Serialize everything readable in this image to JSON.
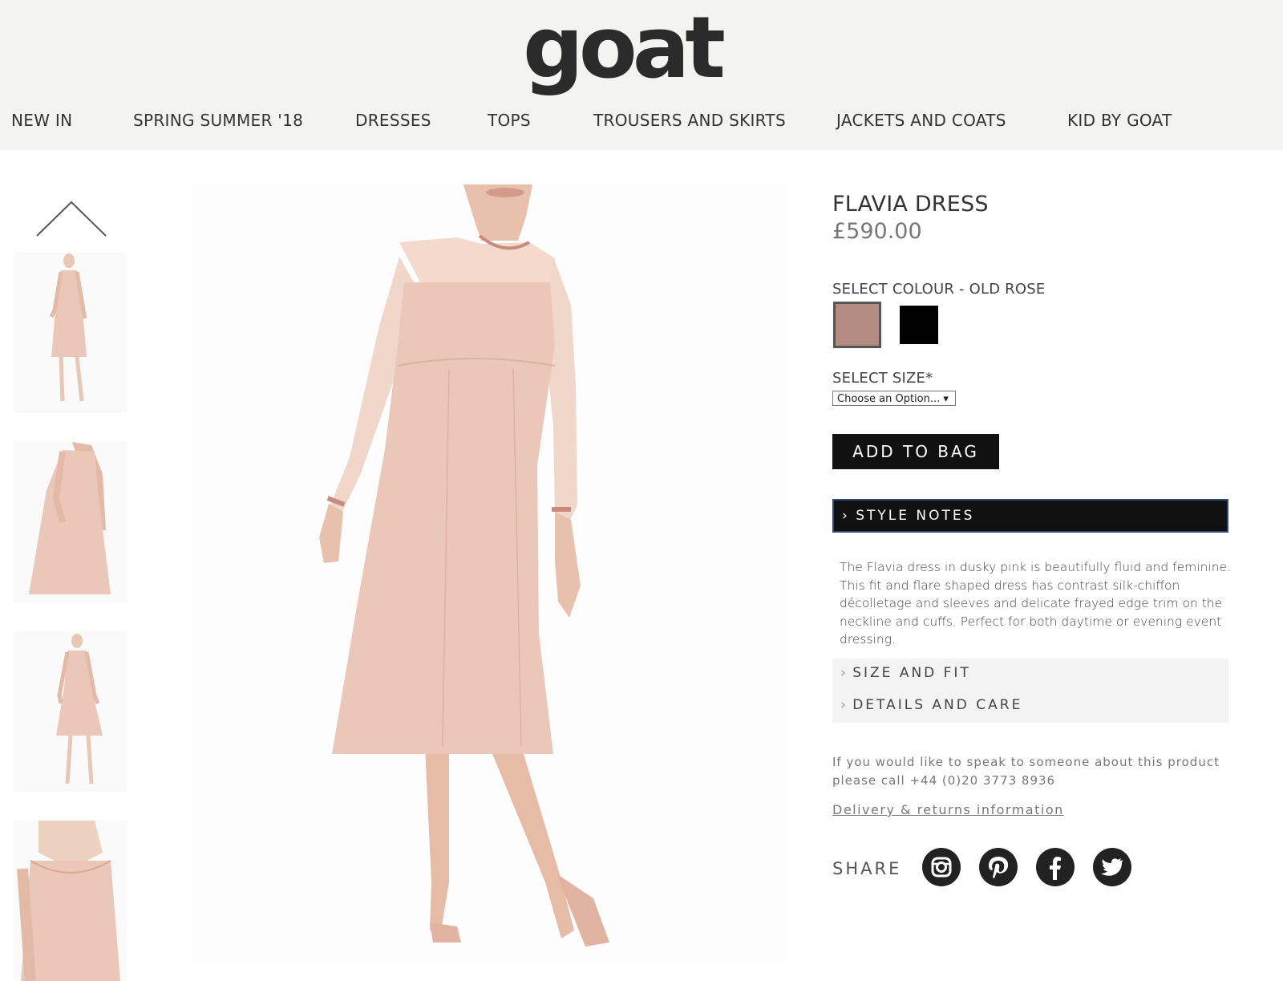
{
  "header": {
    "logo": "goat",
    "nav": [
      "NEW IN",
      "SPRING SUMMER '18",
      "DRESSES",
      "TOPS",
      "TROUSERS AND SKIRTS",
      "JACKETS AND COATS",
      "KID BY GOAT"
    ]
  },
  "gallery": {
    "up_arrow_icon": "chevron-up-icon",
    "thumbnail_count": 4
  },
  "product": {
    "title": "FLAVIA DRESS",
    "price": "£590.00",
    "colour_label": "SELECT COLOUR - OLD ROSE",
    "colours": [
      {
        "name": "old-rose",
        "hex": "#b48b80",
        "selected": true
      },
      {
        "name": "black",
        "hex": "#000000",
        "selected": false
      }
    ],
    "size_label": "SELECT SIZE*",
    "size_select": "Choose an Option... ▾",
    "add_to_bag": "ADD TO BAG",
    "style_notes": "STYLE NOTES",
    "description": "The Flavia dress in dusky pink is beautifully fluid and feminine. This fit and flare shaped dress has contrast silk-chiffon décolletage and sleeves and delicate frayed edge trim on the neckline and cuffs. Perfect for both daytime or evening event dressing.",
    "size_and_fit": "SIZE AND FIT",
    "details_and_care": "DETAILS AND CARE",
    "help_text_1": "If you would like to speak to someone about this product",
    "help_text_2": "please call +44 (0)20 3773 8936",
    "delivery_link": "Delivery & returns information",
    "share_label": "SHARE",
    "social_icons": [
      "instagram-icon",
      "pinterest-icon",
      "facebook-icon",
      "twitter-icon"
    ]
  },
  "colors": {
    "header_bg": "#f3f3f2",
    "dress": "#eac7b9",
    "button_dark": "#111111",
    "accordion_border": "#2f4b7c"
  }
}
